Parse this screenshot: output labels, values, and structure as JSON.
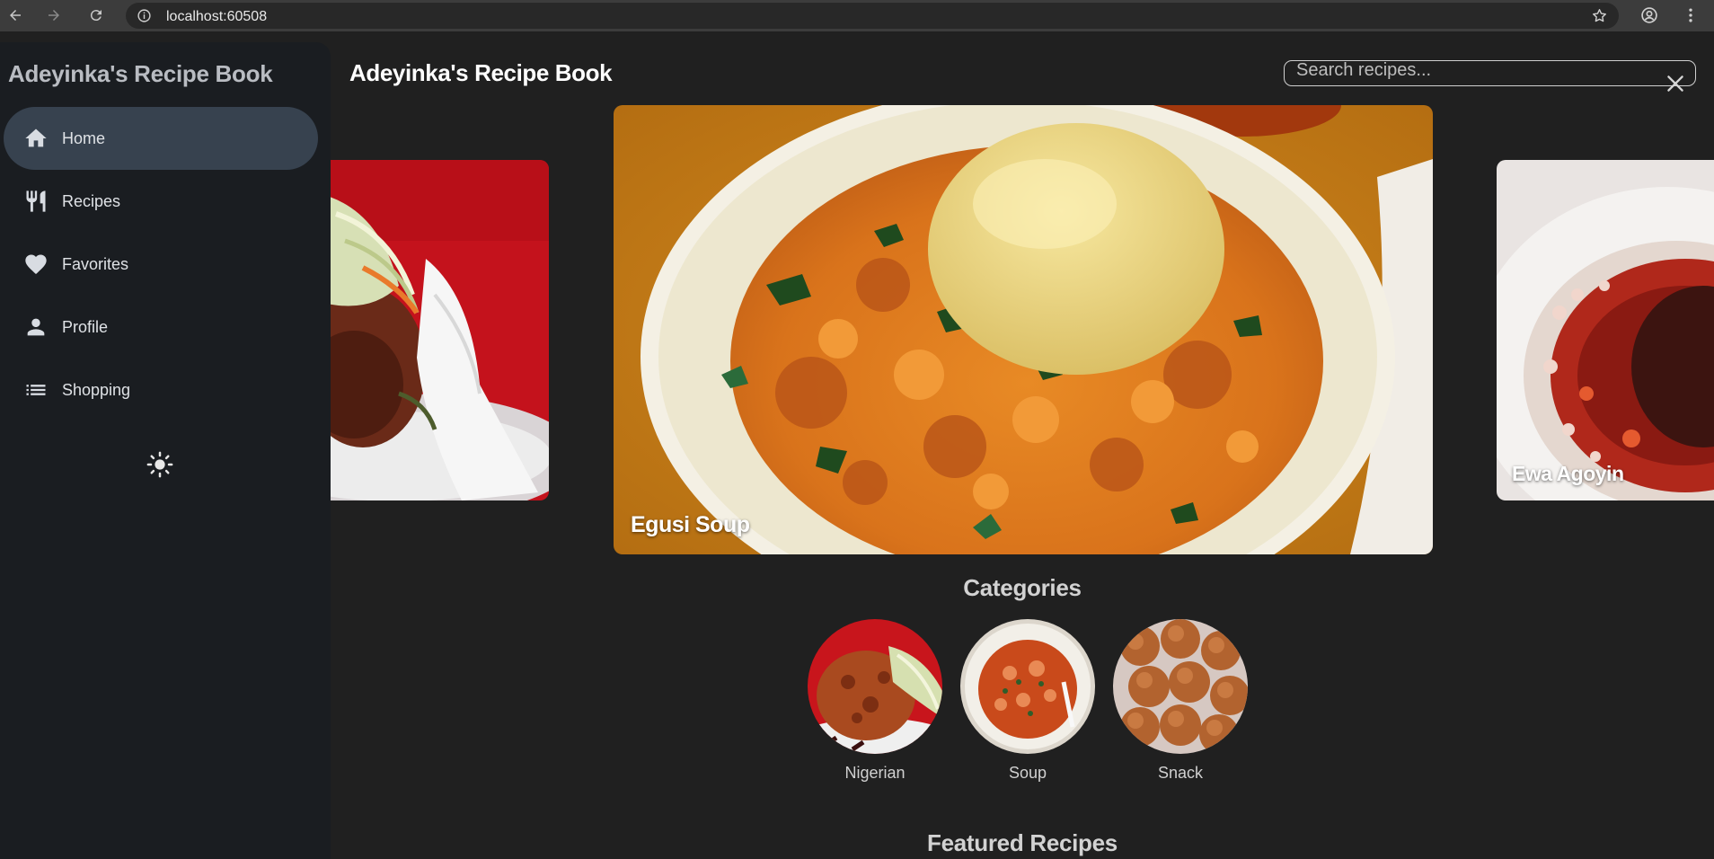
{
  "browser": {
    "url": "localhost:60508",
    "icons": [
      "back-icon",
      "forward-icon",
      "reload-icon",
      "site-info-icon",
      "bookmark-star-icon",
      "profile-icon",
      "menu-dots-icon"
    ]
  },
  "sidebar": {
    "brand": "Adeyinka's Recipe Book",
    "items": [
      {
        "label": "Home",
        "icon": "home-icon",
        "active": true
      },
      {
        "label": "Recipes",
        "icon": "fork-knife-icon",
        "active": false
      },
      {
        "label": "Favorites",
        "icon": "heart-icon",
        "active": false
      },
      {
        "label": "Profile",
        "icon": "person-icon",
        "active": false
      },
      {
        "label": "Shopping",
        "icon": "list-icon",
        "active": false
      }
    ],
    "theme_toggle_icon": "sun-icon"
  },
  "header": {
    "title": "Adeyinka's Recipe Book",
    "search_placeholder": "Search recipes...",
    "close_icon": "close-icon"
  },
  "carousel": {
    "slides": [
      {
        "caption": "",
        "position": "previous"
      },
      {
        "caption": "Egusi Soup",
        "position": "current"
      },
      {
        "caption": "Ewa Agoyin",
        "position": "next"
      }
    ]
  },
  "categories": {
    "title": "Categories",
    "items": [
      {
        "label": "Nigerian"
      },
      {
        "label": "Soup"
      },
      {
        "label": "Snack"
      }
    ]
  },
  "featured": {
    "title": "Featured Recipes"
  },
  "colors": {
    "background": "#202020",
    "sidebar": "#1a1d21",
    "active_nav": "#37424f",
    "browser_chrome": "#3c3c3c"
  }
}
